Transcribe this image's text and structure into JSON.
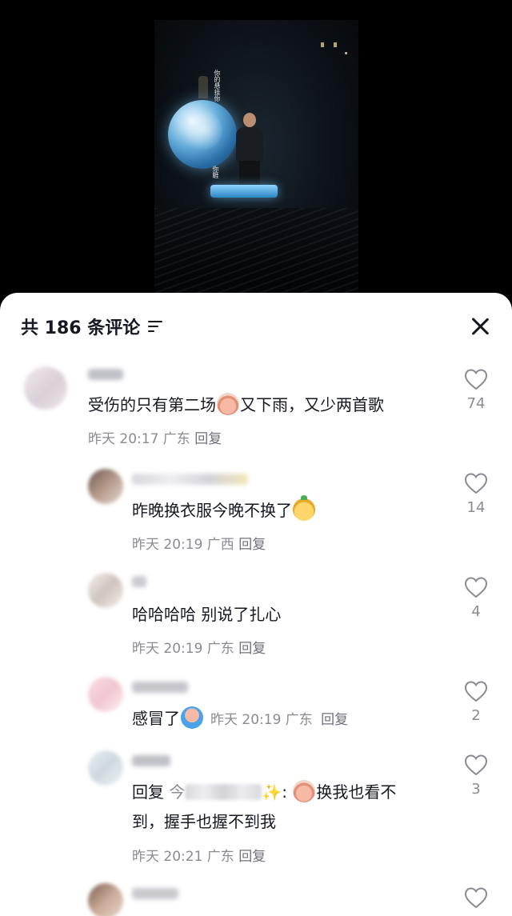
{
  "video": {
    "lyrics_left": "你的悬挂你",
    "lyrics_right": "你睚"
  },
  "header": {
    "count_label": "共 186 条评论",
    "filter_icon": "filter-icon",
    "close_icon": "close-icon"
  },
  "comments": [
    {
      "text": "受伤的只有第二场",
      "text_after": "又下雨，又少两首歌",
      "emoji": "crying-face-emoji",
      "meta": "昨天 20:17 广东",
      "reply_label": "回复",
      "likes": "74"
    },
    {
      "text": "昨晚换衣服今晚不换了",
      "emoji": "smiling-face-emoji",
      "meta": "昨天 20:19 广西",
      "reply_label": "回复",
      "likes": "14"
    },
    {
      "text": "哈哈哈哈 别说了扎心",
      "meta": "昨天 20:19 广东",
      "reply_label": "回复",
      "likes": "4"
    },
    {
      "text": "感冒了",
      "emoji": "rain-crying-emoji",
      "meta": "昨天 20:19 广东",
      "reply_label": "回复",
      "likes": "2"
    },
    {
      "reply_prefix": "回复",
      "reply_to_visible": "今",
      "sparkle": "✨",
      "colon": ":",
      "text_line1": "换我也看不",
      "text_line2": "到，握手也握不到我",
      "emoji": "crying-face-emoji",
      "meta": "昨天 20:21 广东",
      "reply_label": "回复",
      "likes": "3"
    },
    {
      "likes": ""
    }
  ]
}
